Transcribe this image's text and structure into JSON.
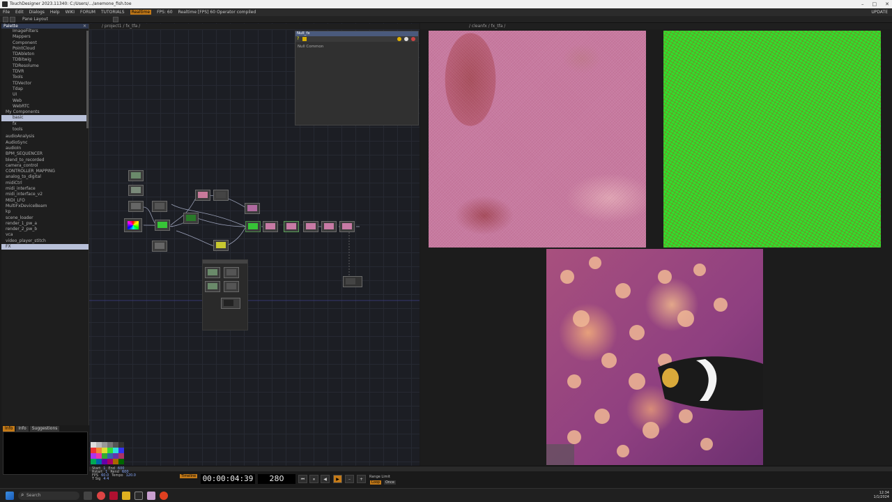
{
  "window": {
    "title": "TouchDesigner 2023.11340: C:/Users/.../anemone_fish.toe",
    "status": "Realtime  [FPS] 60  Operator compiled"
  },
  "menu": {
    "items": [
      "File",
      "Edit",
      "Dialogs",
      "Help",
      "WIKI",
      "FORUM",
      "TUTORIALS"
    ],
    "fps_label": "FPS: 60",
    "realtime": "Realtime",
    "update_label": "UPDATE"
  },
  "toolbar": {
    "layout_label": "Pane Layout"
  },
  "palette": {
    "title": "Palette",
    "items": [
      "ImageFilters",
      "Mappers",
      "Component",
      "PointCloud",
      "TDAbleton",
      "TDBitwig",
      "TDResolume",
      "TDVR",
      "Tools",
      "TDVector",
      "Tdap",
      "UI",
      "Web",
      "WebRTC"
    ],
    "my_components_label": "My Components",
    "sub_items": [
      "basic",
      "fx",
      "tools"
    ],
    "list": [
      "audioAnalysis",
      "AudioSync",
      "audioIn",
      "BPM_SEQUENCER",
      "blend_to_recorded",
      "camera_control",
      "CONTROLLER_MAPPING",
      "analog_to_digital",
      "midiCtrl",
      "midi_interface",
      "midi_interface_v2",
      "MIDI_LFO",
      "MultiFxDeviceBeam",
      "kp",
      "scene_loader",
      "render_1_pw_a",
      "render_2_pw_b",
      "vca",
      "video_player_stitch",
      "FX"
    ],
    "selected_list_item": "FX"
  },
  "info_tabs": [
    "Info",
    "Info",
    "Suggestions"
  ],
  "network": {
    "path": "/ project1 / fx_tfa /",
    "null_panel_title": "Null_fx",
    "null_panel_text": "Null Common"
  },
  "viewer": {
    "path": "/ cleanfx / fx_tfa /"
  },
  "transport": {
    "timecode": "00:00:04:39",
    "frame": "280",
    "range_label": "Range Limit",
    "loop_label": "Loop",
    "once_label": "Once",
    "timeline_label": "Timeline"
  },
  "stats": {
    "labels": [
      "Start",
      "End",
      "Rstart",
      "Rend",
      "FPS",
      "Tempo",
      "T Sig"
    ],
    "values": [
      "1",
      "600",
      "1",
      "600",
      "60.0",
      "120.0",
      "4 4"
    ]
  },
  "taskbar": {
    "search_placeholder": "Search",
    "time": "12:34",
    "date": "1/1/2024"
  }
}
